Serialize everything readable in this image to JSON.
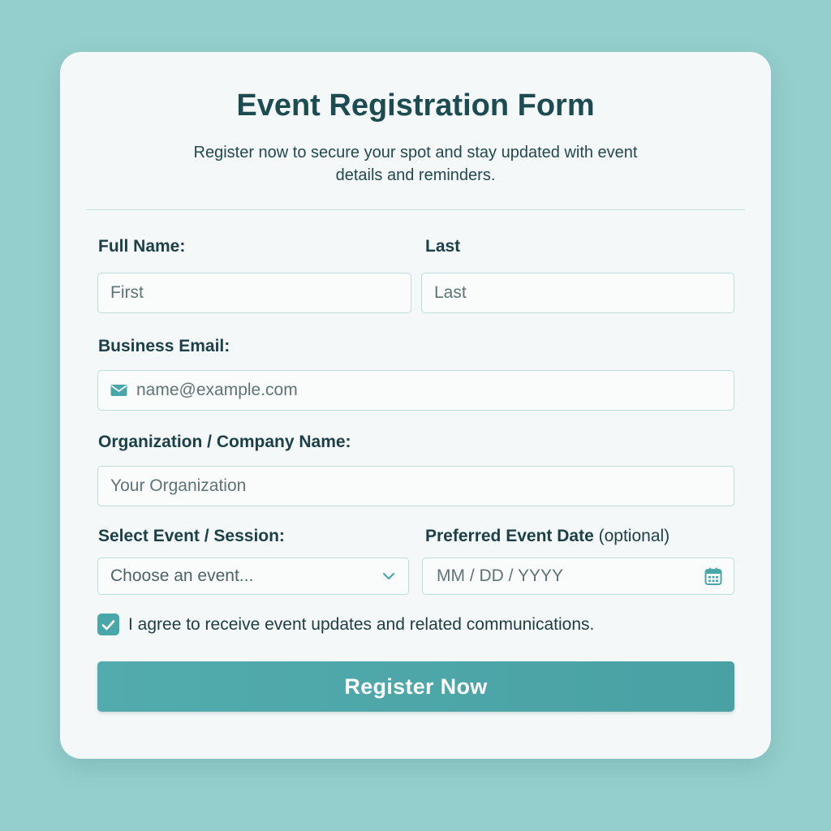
{
  "form": {
    "title": "Event Registration Form",
    "subtitle": "Register now to secure your spot and stay updated with event details and reminders.",
    "full_name_label": "Full Name:",
    "first_placeholder": "First",
    "last_label": "Last",
    "last_placeholder": "Last",
    "email_label": "Business Email:",
    "email_placeholder": "name@example.com",
    "organization_label": "Organization / Company Name:",
    "organization_placeholder": "Your Organization",
    "event_label": "Select Event / Session:",
    "event_selected": "Choose an event...",
    "date_label": "Preferred Event Date",
    "date_optional": "(optional)",
    "date_placeholder": "MM / DD / YYYY",
    "consent_text": "I agree to receive event updates and related communications.",
    "consent_checked": true,
    "submit_label": "Register Now"
  },
  "icons": {
    "email": "envelope-icon",
    "dropdown": "chevron-down-icon",
    "date": "calendar-icon",
    "checkbox": "checkmark-icon"
  },
  "colors": {
    "background": "#95cfcd",
    "card": "#f4f8f8",
    "heading": "#1c4c52",
    "accent": "#4aa7a9",
    "field_border": "#bfdcdb"
  }
}
